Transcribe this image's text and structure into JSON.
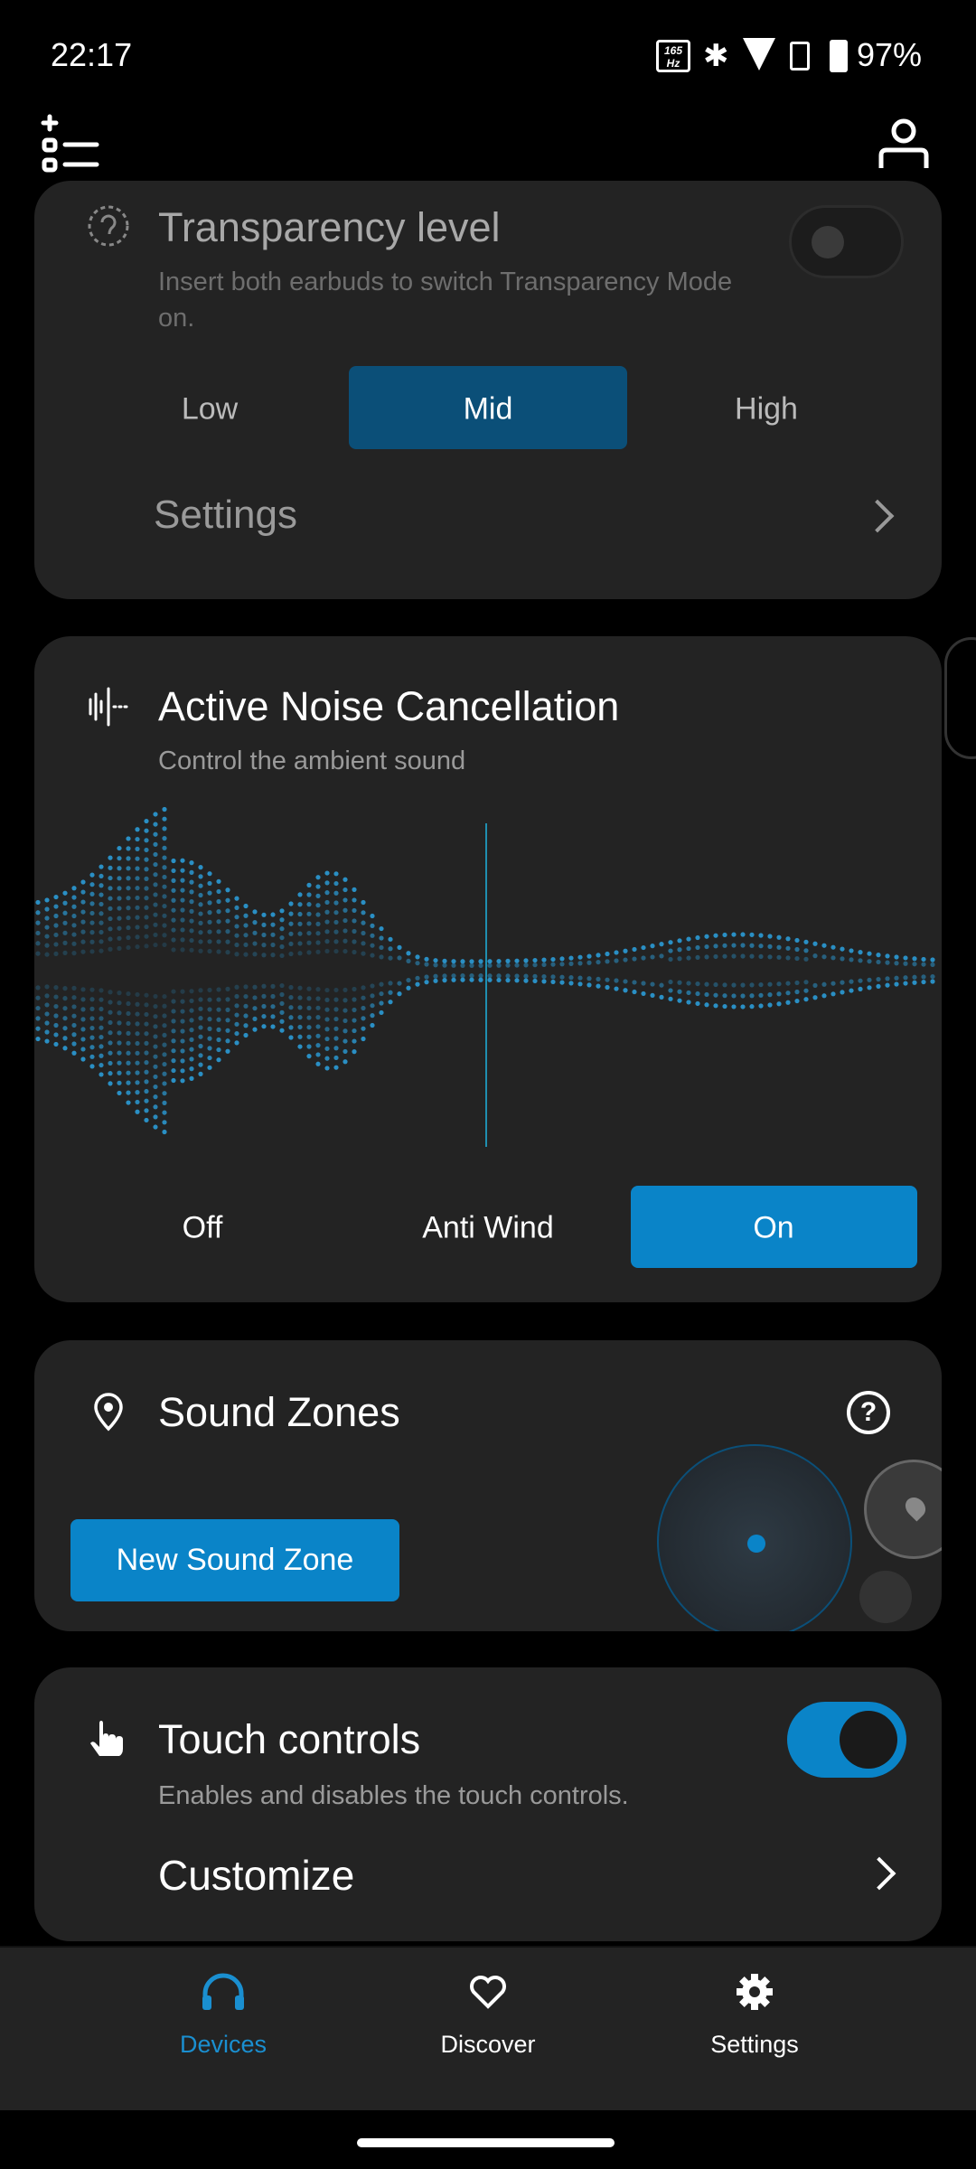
{
  "status_bar": {
    "time": "22:17",
    "refresh_rate": "165 Hz",
    "battery": "97%"
  },
  "header": {
    "left_icon": "add-list-icon",
    "right_icon": "profile-icon"
  },
  "transparency": {
    "title": "Transparency level",
    "subtitle": "Insert both earbuds to switch Transparency Mode on.",
    "enabled": false,
    "levels": [
      "Low",
      "Mid",
      "High"
    ],
    "selected": "Mid",
    "settings_label": "Settings"
  },
  "anc": {
    "title": "Active Noise Cancellation",
    "subtitle": "Control the ambient sound",
    "modes": [
      "Off",
      "Anti Wind",
      "On"
    ],
    "selected": "On"
  },
  "sound_zones": {
    "title": "Sound Zones",
    "new_button": "New Sound Zone"
  },
  "touch": {
    "title": "Touch controls",
    "subtitle": "Enables and disables the touch controls.",
    "enabled": true,
    "customize_label": "Customize"
  },
  "nav": {
    "items": [
      {
        "label": "Devices",
        "icon": "headphones-icon",
        "active": true
      },
      {
        "label": "Discover",
        "icon": "heart-icon",
        "active": false
      },
      {
        "label": "Settings",
        "icon": "gear-icon",
        "active": false
      }
    ]
  },
  "colors": {
    "accent": "#0a84c8",
    "accent_dark": "#0b4f78",
    "card": "#232323",
    "nav_active": "#1a8fd0"
  }
}
